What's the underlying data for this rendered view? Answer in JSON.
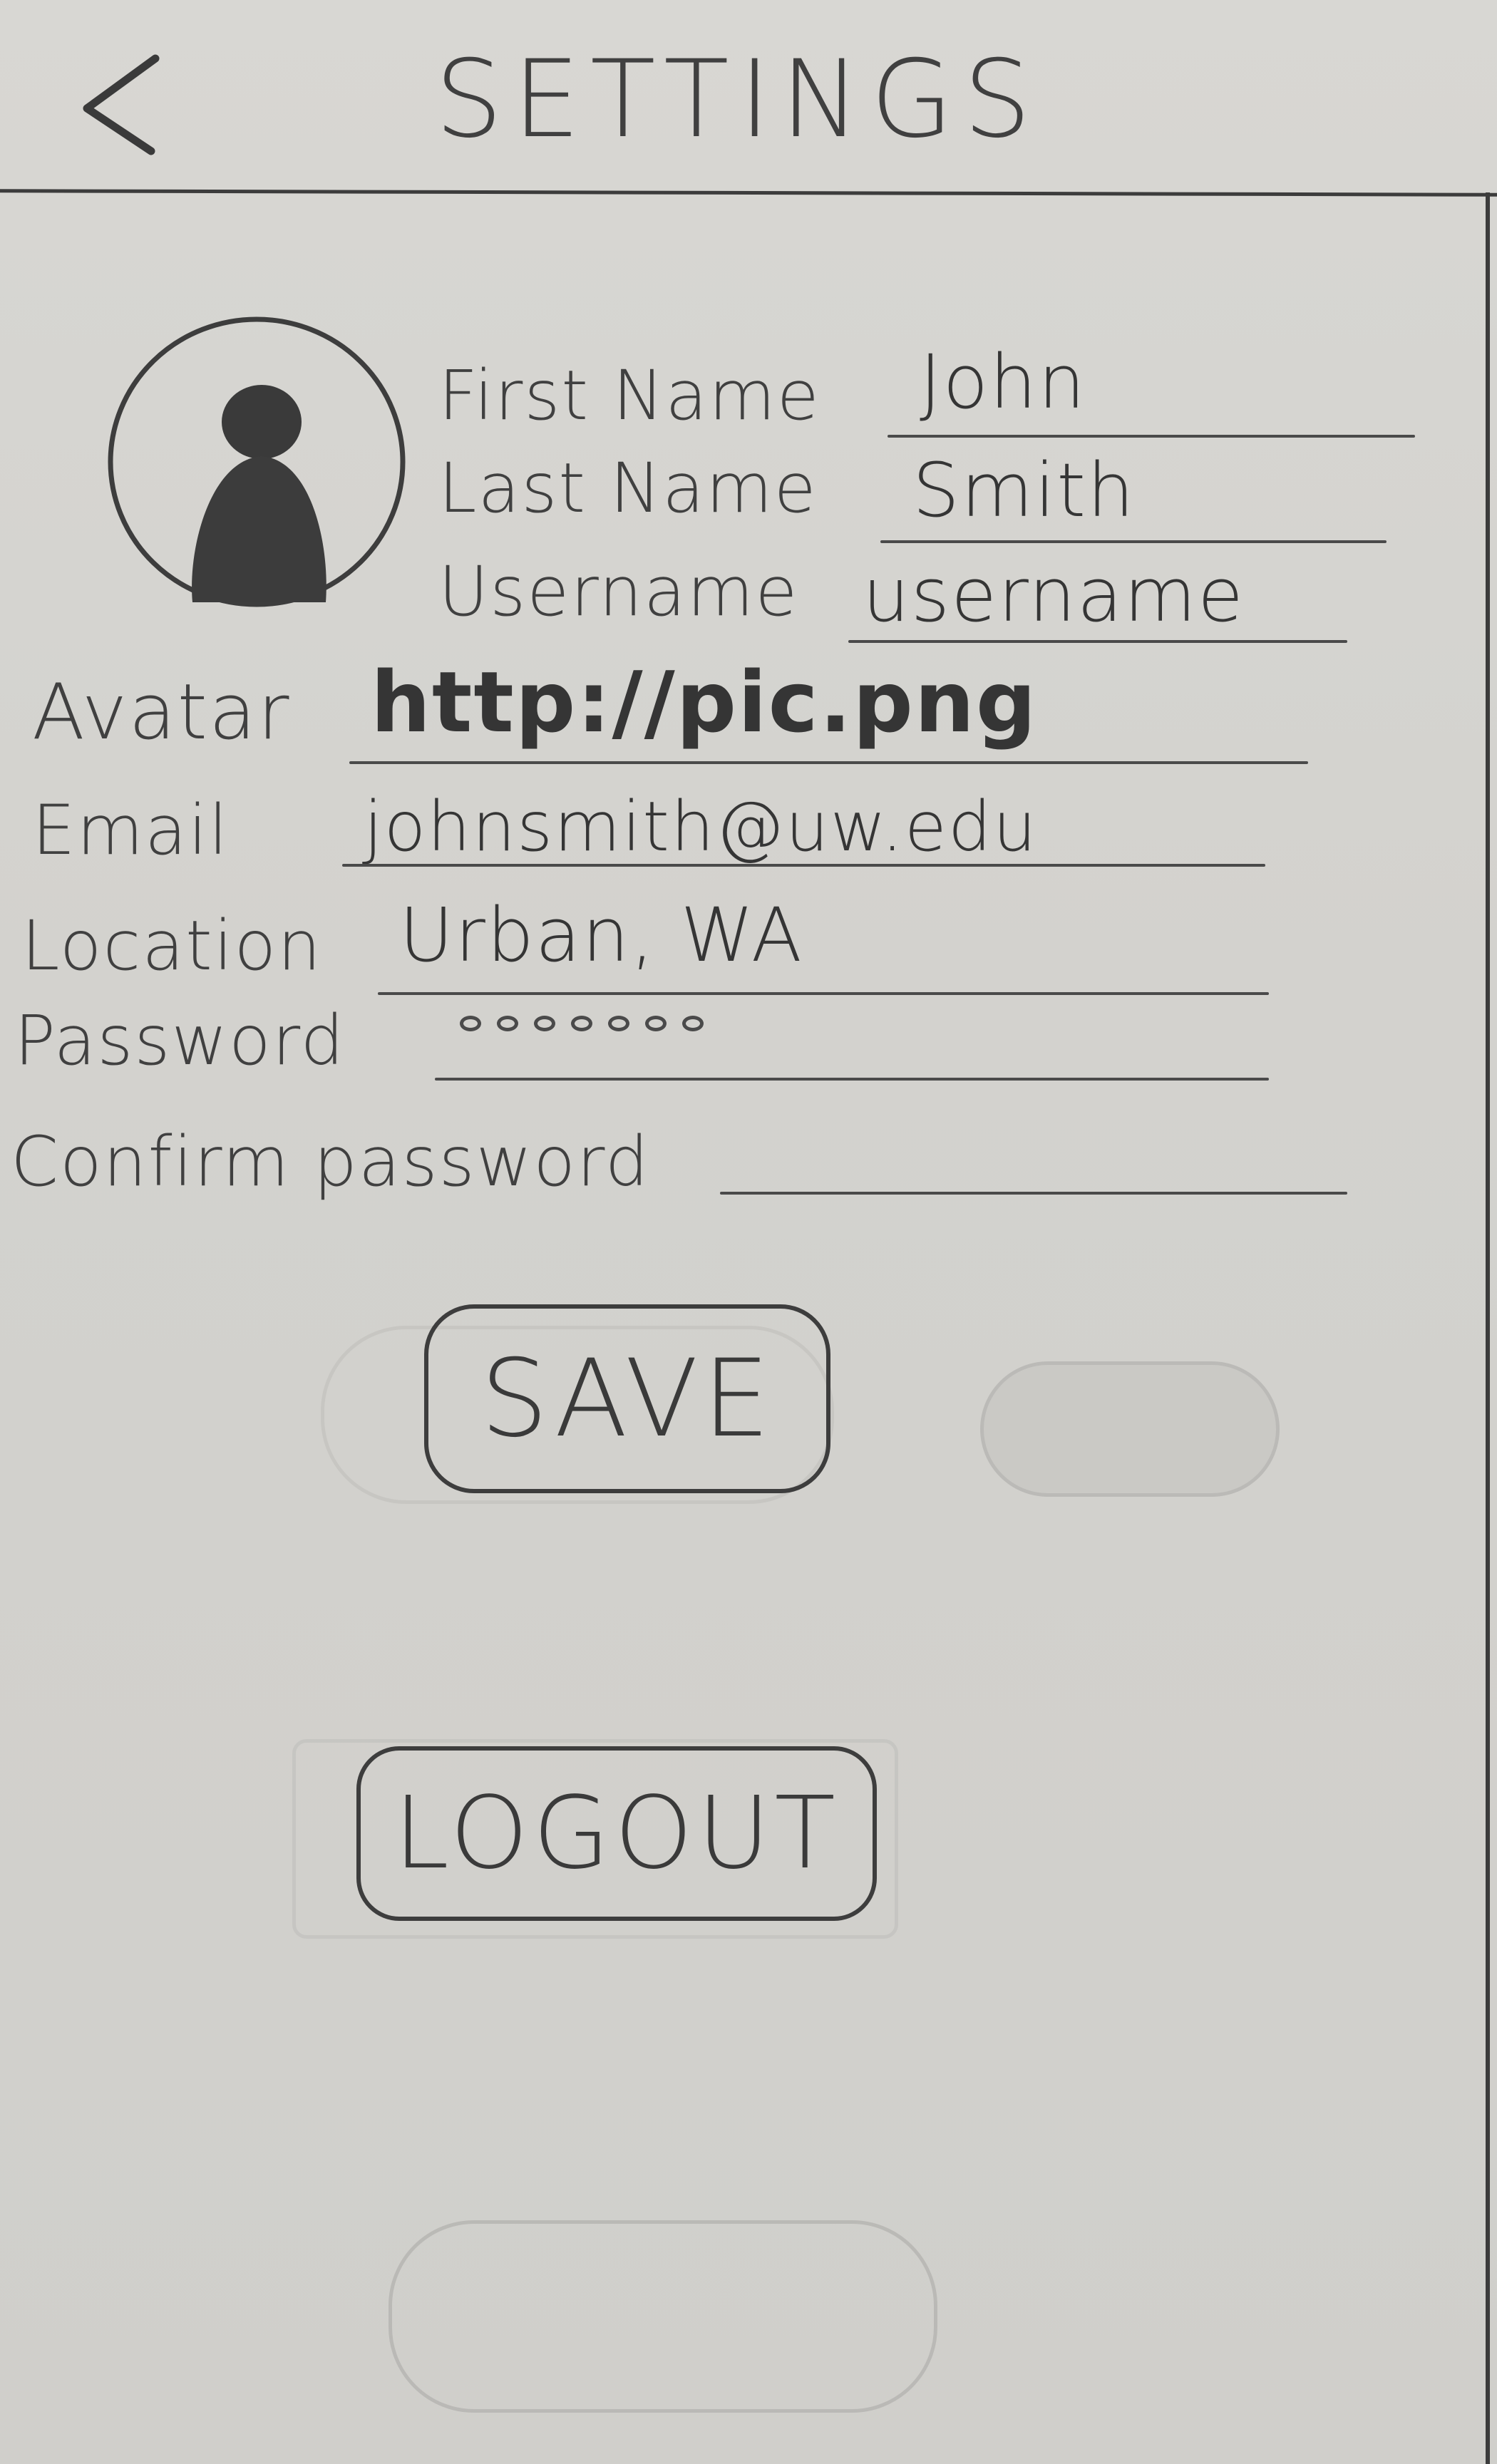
{
  "header": {
    "title": "SETTINGS",
    "back_icon": "chevron-left-icon"
  },
  "profile": {
    "avatar_icon": "person-silhouette-icon",
    "first_name_label": "First Name",
    "first_name_value": "John",
    "last_name_label": "Last Name",
    "last_name_value": "Smith",
    "username_label": "Username",
    "username_value": "username"
  },
  "fields": {
    "avatar_label": "Avatar",
    "avatar_value": "http://pic.png",
    "email_label": "Email",
    "email_value": "johnsmith@uw.edu",
    "location_label": "Location",
    "location_value": "Urban, WA",
    "password_label": "Password",
    "confirm_password_label": "Confirm password",
    "confirm_password_value": ""
  },
  "buttons": {
    "save_label": "SAVE",
    "logout_label": "LOGOUT"
  }
}
